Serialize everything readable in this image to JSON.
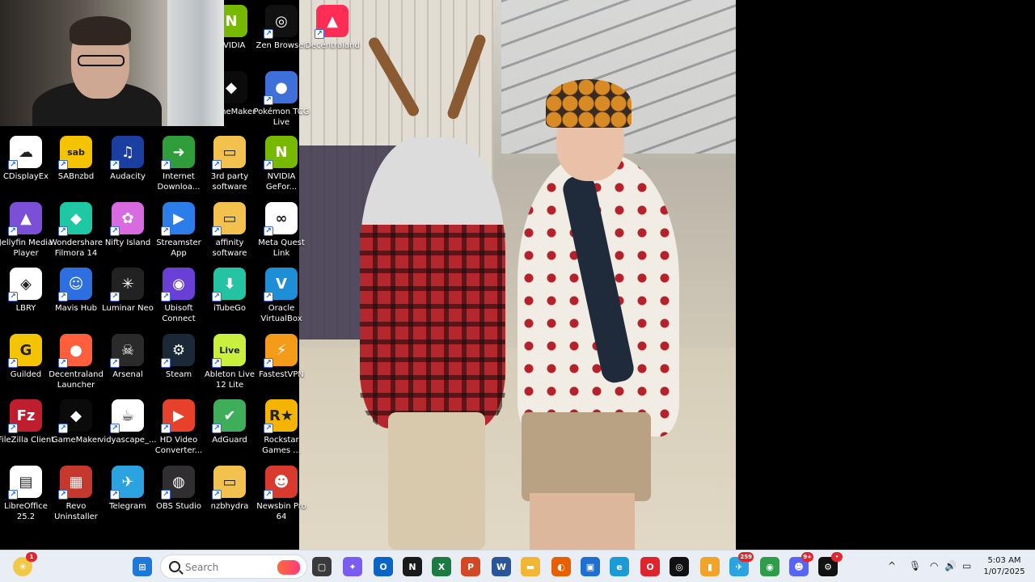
{
  "desktop_icons": [
    {
      "label": "NVIDIA",
      "icon": "nvidia-icon",
      "color": "#76b900"
    },
    {
      "label": "Zen Browser",
      "icon": "zen-browser-icon",
      "color": "#111111"
    },
    {
      "label": "Decentraland",
      "icon": "decentraland-icon",
      "color": "#ff2d55"
    },
    {
      "label": "GameMaker",
      "icon": "gamemaker-icon",
      "color": "#0b0b0b"
    },
    {
      "label": "Pokémon TCG Live",
      "icon": "pokemon-tcg-icon",
      "color": "#3f6fd8"
    },
    {
      "label": "CDisplayEx",
      "icon": "cdisplayex-icon",
      "color": "#ffffff"
    },
    {
      "label": "SABnzbd",
      "icon": "sabnzbd-icon",
      "color": "#f5c400"
    },
    {
      "label": "Audacity",
      "icon": "audacity-icon",
      "color": "#1a3fa0"
    },
    {
      "label": "Internet Downloa...",
      "icon": "idm-icon",
      "color": "#2f9d3a"
    },
    {
      "label": "3rd party software",
      "icon": "folder-icon",
      "color": "#f2c14e"
    },
    {
      "label": "NVIDIA GeFor...",
      "icon": "geforce-icon",
      "color": "#76b900"
    },
    {
      "label": "Jellyfin Media Player",
      "icon": "jellyfin-icon",
      "color": "#7b4fd6"
    },
    {
      "label": "Wondershare Filmora 14",
      "icon": "filmora-icon",
      "color": "#1ec8a5"
    },
    {
      "label": "Nifty Island",
      "icon": "nifty-island-icon",
      "color": "#d86be0"
    },
    {
      "label": "Streamster App",
      "icon": "streamster-icon",
      "color": "#2b7de9"
    },
    {
      "label": "affinity software",
      "icon": "folder-icon",
      "color": "#f2c14e"
    },
    {
      "label": "Meta Quest Link",
      "icon": "meta-icon",
      "color": "#ffffff"
    },
    {
      "label": "LBRY",
      "icon": "lbry-icon",
      "color": "#ffffff"
    },
    {
      "label": "Mavis Hub",
      "icon": "mavis-hub-icon",
      "color": "#2d6fe0"
    },
    {
      "label": "Luminar Neo",
      "icon": "luminar-icon",
      "color": "#222222"
    },
    {
      "label": "Ubisoft Connect",
      "icon": "ubisoft-icon",
      "color": "#6a3fd6"
    },
    {
      "label": "iTubeGo",
      "icon": "itubego-icon",
      "color": "#23c3a4"
    },
    {
      "label": "Oracle VirtualBox",
      "icon": "virtualbox-icon",
      "color": "#1e8fd6"
    },
    {
      "label": "Guilded",
      "icon": "guilded-icon",
      "color": "#f5c400"
    },
    {
      "label": "Decentraland Launcher",
      "icon": "decentraland-launcher-icon",
      "color": "#ff5f3d"
    },
    {
      "label": "Arsenal",
      "icon": "arsenal-icon",
      "color": "#2a2a2a"
    },
    {
      "label": "Steam",
      "icon": "steam-icon",
      "color": "#1b2838"
    },
    {
      "label": "Ableton Live 12 Lite",
      "icon": "ableton-icon",
      "color": "#c8f03c"
    },
    {
      "label": "FastestVPN",
      "icon": "fastestvpn-icon",
      "color": "#f59b1a"
    },
    {
      "label": "FileZilla Client",
      "icon": "filezilla-icon",
      "color": "#bf1e2e"
    },
    {
      "label": "GameMaker",
      "icon": "gamemaker-icon",
      "color": "#0b0b0b"
    },
    {
      "label": "vidyascape_...",
      "icon": "java-icon",
      "color": "#ffffff"
    },
    {
      "label": "HD Video Converter...",
      "icon": "hd-video-converter-icon",
      "color": "#e8412b"
    },
    {
      "label": "AdGuard",
      "icon": "adguard-icon",
      "color": "#3fae5a"
    },
    {
      "label": "Rockstar Games ...",
      "icon": "rockstar-icon",
      "color": "#f5b400"
    },
    {
      "label": "LibreOffice 25.2",
      "icon": "libreoffice-icon",
      "color": "#ffffff"
    },
    {
      "label": "Revo Uninstaller",
      "icon": "revo-icon",
      "color": "#c4382e"
    },
    {
      "label": "Telegram",
      "icon": "telegram-icon",
      "color": "#2aa3e0"
    },
    {
      "label": "OBS Studio",
      "icon": "obs-icon",
      "color": "#302e31"
    },
    {
      "label": "nzbhydra",
      "icon": "folder-icon",
      "color": "#f2c14e"
    },
    {
      "label": "Newsbin Pro 64",
      "icon": "newsbin-icon",
      "color": "#d83a2e"
    }
  ],
  "icon_glyphs": {
    "nvidia-icon": "N",
    "zen-browser-icon": "◎",
    "decentraland-icon": "▲",
    "gamemaker-icon": "◆",
    "pokemon-tcg-icon": "●",
    "cdisplayex-icon": "☁",
    "sabnzbd-icon": "sab",
    "audacity-icon": "♫",
    "idm-icon": "➜",
    "folder-icon": "▭",
    "geforce-icon": "N",
    "jellyfin-icon": "▲",
    "filmora-icon": "◆",
    "nifty-island-icon": "✿",
    "streamster-icon": "▶",
    "meta-icon": "∞",
    "lbry-icon": "◈",
    "mavis-hub-icon": "☺",
    "luminar-icon": "✳",
    "ubisoft-icon": "◉",
    "itubego-icon": "⬇",
    "virtualbox-icon": "V",
    "guilded-icon": "G",
    "decentraland-launcher-icon": "●",
    "arsenal-icon": "☠",
    "steam-icon": "⚙",
    "ableton-icon": "Live",
    "fastestvpn-icon": "⚡",
    "filezilla-icon": "Fz",
    "java-icon": "☕",
    "hd-video-converter-icon": "▶",
    "adguard-icon": "✔",
    "rockstar-icon": "R★",
    "libreoffice-icon": "▤",
    "revo-icon": "▦",
    "telegram-icon": "✈",
    "obs-icon": "◍",
    "newsbin-icon": "☻"
  },
  "taskbar": {
    "weather_badge": "1",
    "search_placeholder": "Search",
    "apps": [
      {
        "name": "file-explorer-gray",
        "glyph": "▢",
        "color": "#3a3a3a"
      },
      {
        "name": "copilot",
        "glyph": "✦",
        "color": "#7a5cf0"
      },
      {
        "name": "outlook",
        "glyph": "O",
        "color": "#0a64c8"
      },
      {
        "name": "notion",
        "glyph": "N",
        "color": "#1a1a1a"
      },
      {
        "name": "excel",
        "glyph": "X",
        "color": "#1d7a43"
      },
      {
        "name": "powerpoint",
        "glyph": "P",
        "color": "#d24726"
      },
      {
        "name": "word",
        "glyph": "W",
        "color": "#2a5699"
      },
      {
        "name": "file-explorer",
        "glyph": "▬",
        "color": "#f2b632"
      },
      {
        "name": "firefox",
        "glyph": "◐",
        "color": "#e66000"
      },
      {
        "name": "microsoft-store",
        "glyph": "▣",
        "color": "#1f6fd1"
      },
      {
        "name": "edge",
        "glyph": "e",
        "color": "#1b9bd6"
      },
      {
        "name": "opera",
        "glyph": "O",
        "color": "#e0242e"
      },
      {
        "name": "zen-browser",
        "glyph": "◎",
        "color": "#111111"
      },
      {
        "name": "media-app",
        "glyph": "▮",
        "color": "#f2a42a"
      },
      {
        "name": "telegram",
        "glyph": "✈",
        "color": "#2aa3e0",
        "badge": "259"
      },
      {
        "name": "globe-app",
        "glyph": "◉",
        "color": "#2e9d4a"
      },
      {
        "name": "discord",
        "glyph": "☻",
        "color": "#5865f2",
        "badge": "9+"
      },
      {
        "name": "steam-tray",
        "glyph": "⚙",
        "color": "#111111",
        "badge": "•"
      }
    ],
    "tray": {
      "chevron": "^",
      "mic": "🎙",
      "wifi": "◠",
      "volume": "🔊",
      "battery": "▭"
    },
    "clock": {
      "time": "5:03 AM",
      "date": "1/07/2025"
    }
  }
}
